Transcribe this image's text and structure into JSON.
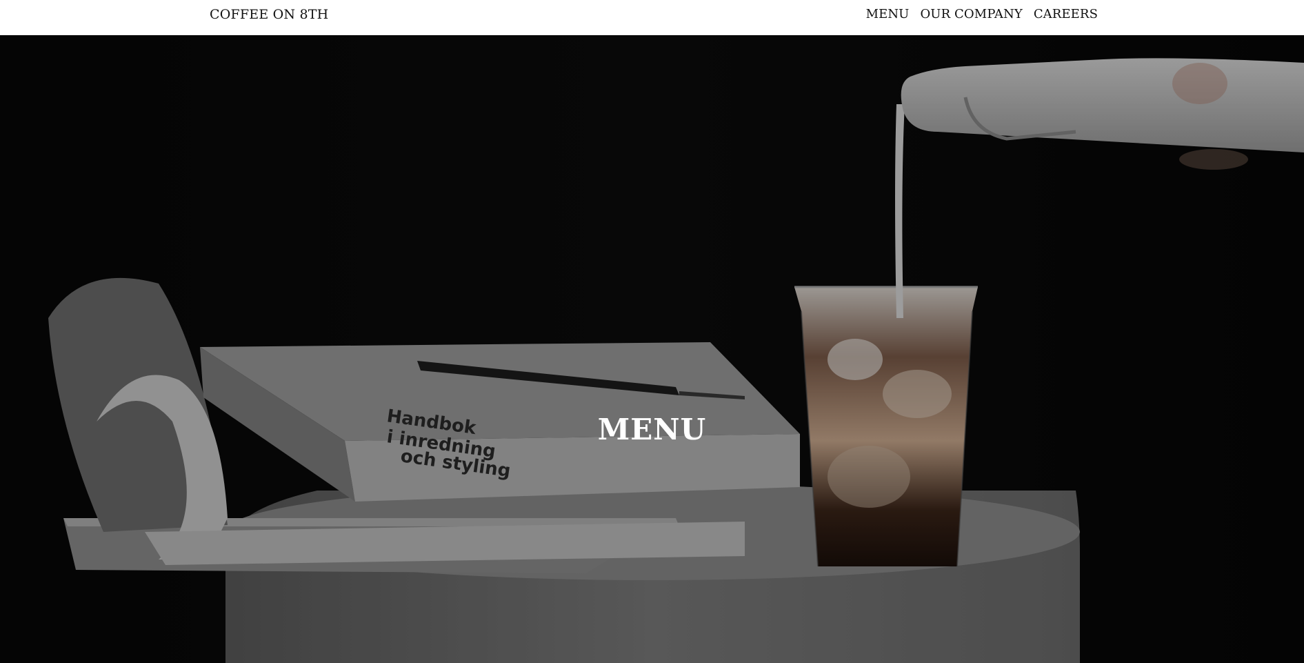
{
  "header": {
    "brand": "COFFEE ON 8TH",
    "nav": [
      {
        "label": "MENU"
      },
      {
        "label": "OUR COMPANY"
      },
      {
        "label": "CAREERS"
      }
    ]
  },
  "hero": {
    "title": "MENU",
    "overlay_color": "#000000"
  },
  "colors": {
    "header_bg": "#ffffff",
    "text_dark": "#111111",
    "hero_text": "#ffffff"
  }
}
